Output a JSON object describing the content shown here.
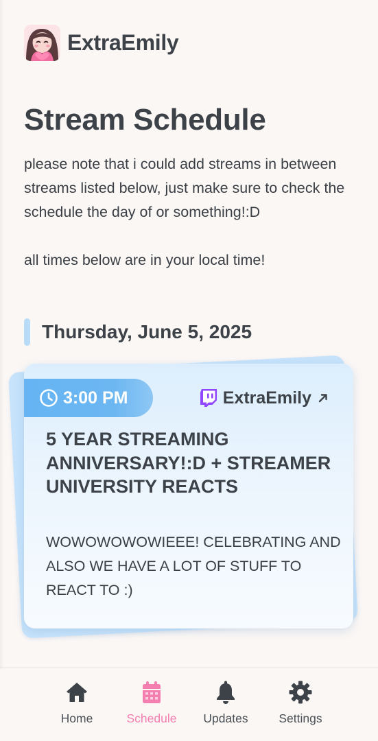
{
  "header": {
    "brand_name": "ExtraEmily",
    "avatar_icon": "emily-avatar-icon"
  },
  "page": {
    "title": "Stream Schedule",
    "note_lines": [
      "please note that i could add streams in between streams listed below, just make sure to check the schedule the day of or something!:D",
      "all times below are in your local time!"
    ]
  },
  "schedule": {
    "date": "Thursday, June 5, 2025",
    "streams": [
      {
        "time": "3:00 PM",
        "channel": "ExtraEmily",
        "platform_icon": "twitch-icon",
        "title": "5 YEAR STREAMING ANNIVERSARY!:D + STREAMER UNIVERSITY REACTS",
        "description": "WOWOWOWOWIEEE! CELEBRATING AND ALSO WE HAVE A LOT OF STUFF TO REACT TO :)"
      }
    ]
  },
  "tabbar": {
    "items": [
      {
        "label": "Home",
        "icon": "home-icon",
        "active": false
      },
      {
        "label": "Schedule",
        "icon": "calendar-icon",
        "active": true
      },
      {
        "label": "Updates",
        "icon": "bell-icon",
        "active": false
      },
      {
        "label": "Settings",
        "icon": "gear-icon",
        "active": false
      }
    ]
  },
  "colors": {
    "accent_blue": "#66b4f3",
    "accent_pink": "#f37fb0",
    "twitch_purple": "#9146ff",
    "text_dark": "#3c4248",
    "background": "#fbf7f5"
  }
}
